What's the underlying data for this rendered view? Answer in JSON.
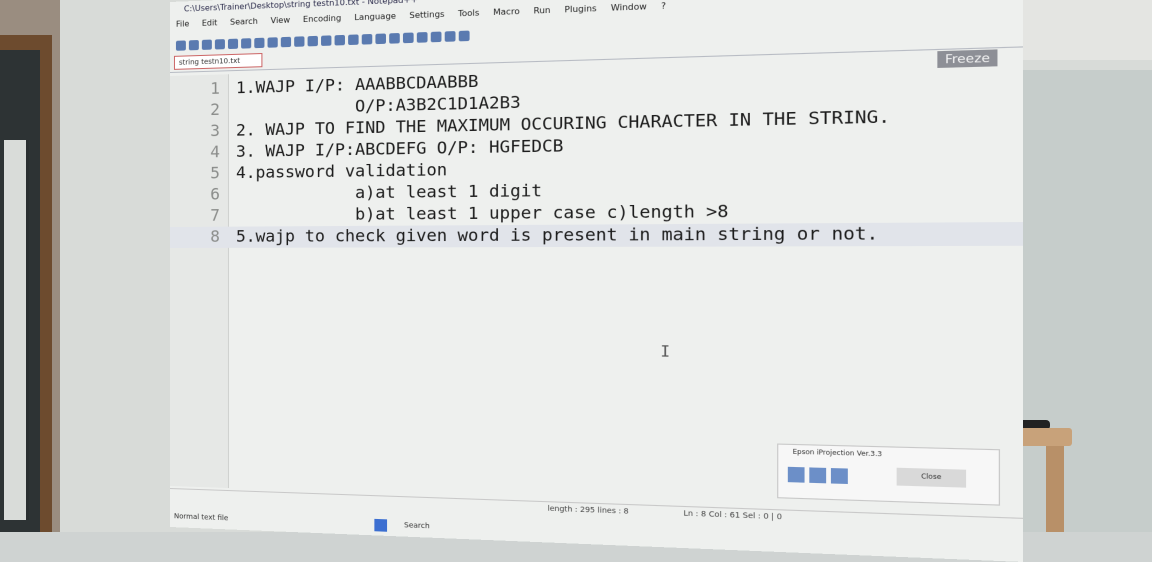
{
  "window": {
    "title": "C:\\Users\\Trainer\\Desktop\\string testn10.txt - Notepad++",
    "menu": [
      "File",
      "Edit",
      "Search",
      "View",
      "Encoding",
      "Language",
      "Settings",
      "Tools",
      "Macro",
      "Run",
      "Plugins",
      "Window",
      "?"
    ],
    "tab_label": "string testn10.txt",
    "freeze_label": "Freeze"
  },
  "editor": {
    "lines": [
      {
        "num": "1",
        "text": "1.WAJP I/P: AAABBCDAABBB"
      },
      {
        "num": "2",
        "text": "            O/P:A3B2C1D1A2B3"
      },
      {
        "num": "3",
        "text": "2. WAJP TO FIND THE MAXIMUM OCCURING CHARACTER IN THE STRING."
      },
      {
        "num": "4",
        "text": "3. WAJP I/P:ABCDEFG O/P: HGFEDCB"
      },
      {
        "num": "5",
        "text": "4.password validation"
      },
      {
        "num": "6",
        "text": "            a)at least 1 digit"
      },
      {
        "num": "7",
        "text": "            b)at least 1 upper case c)length >8"
      },
      {
        "num": "8",
        "text": "5.wajp to check given word is present in main string or not."
      }
    ],
    "cursor_glyph": "I"
  },
  "status": {
    "file_type": "Normal text file",
    "length": "length : 295   lines : 8",
    "position": "Ln : 8   Col : 61   Sel : 0 | 0"
  },
  "taskbar": {
    "search_label": "Search"
  },
  "recorder": {
    "title": "Epson iProjection Ver.3.3",
    "close_label": "Close"
  }
}
